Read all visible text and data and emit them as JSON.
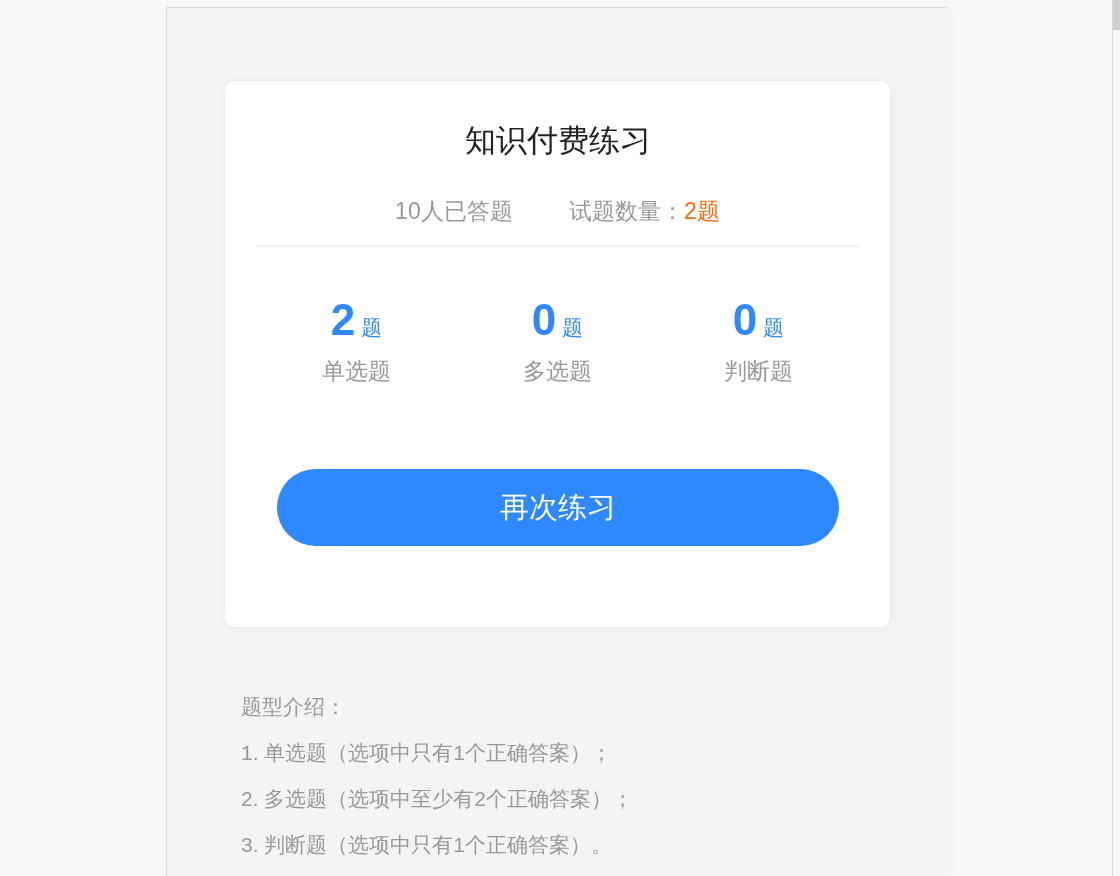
{
  "card": {
    "title": "知识付费练习",
    "answered": "10人已答题",
    "count_label": "试题数量：",
    "count_value": "2题"
  },
  "question_types": [
    {
      "count": "2",
      "unit": "题",
      "label": "单选题"
    },
    {
      "count": "0",
      "unit": "题",
      "label": "多选题"
    },
    {
      "count": "0",
      "unit": "题",
      "label": "判断题"
    }
  ],
  "button": "再次练习",
  "intro": {
    "heading": "题型介绍：",
    "items": [
      "1. 单选题（选项中只有1个正确答案）；",
      "2. 多选题（选项中至少有2个正确答案）；",
      "3. 判断题（选项中只有1个正确答案）。"
    ]
  }
}
